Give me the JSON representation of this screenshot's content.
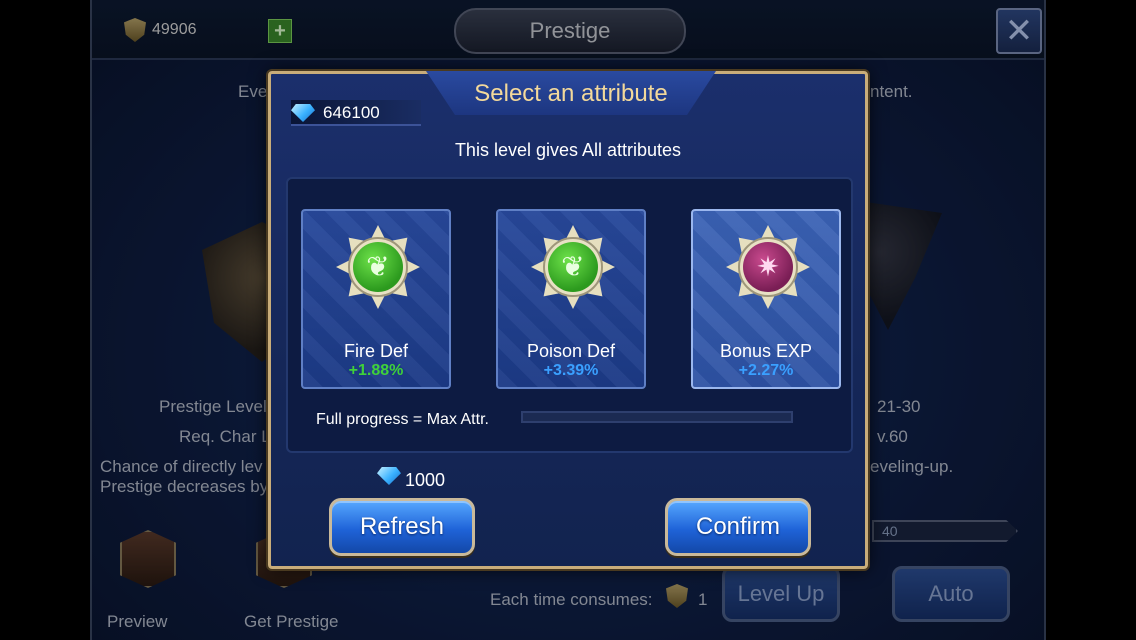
{
  "background": {
    "currency_value": "49906",
    "title": "Prestige",
    "close_glyph": "✕",
    "hint_left": "Eve",
    "hint_right": "ntent.",
    "prestige_level_label": "Prestige Level",
    "prestige_level_value": "21-30",
    "req_char_label": "Req. Char L",
    "req_char_value": "v.60",
    "chance_line1": "Chance of directly lev",
    "chance_line1_right": "eveling-up.",
    "chance_line2": "Prestige decreases by",
    "bar_text": "40",
    "preview_label": "Preview",
    "get_prestige_label": "Get Prestige",
    "consumes_label": "Each time consumes:",
    "consumes_value": "1",
    "level_up_label": "Level Up",
    "auto_label": "Auto"
  },
  "modal": {
    "title": "Select an attribute",
    "gems": "646100",
    "subtitle": "This level gives All attributes",
    "cards": [
      {
        "name": "Fire Def",
        "value": "+1.88%",
        "value_color": "#3fd13a",
        "medal": "green",
        "icon": "leaf-icon",
        "glyph": "❦"
      },
      {
        "name": "Poison Def",
        "value": "+3.39%",
        "value_color": "#3aa0ff",
        "medal": "green",
        "icon": "leaf-icon",
        "glyph": "❦"
      },
      {
        "name": "Bonus EXP",
        "value": "+2.27%",
        "value_color": "#3aa0ff",
        "medal": "purple",
        "icon": "star-icon",
        "glyph": "✷"
      }
    ],
    "progress_label": "Full progress = Max Attr.",
    "progress_fraction": 0,
    "cost": "1000",
    "refresh_label": "Refresh",
    "confirm_label": "Confirm"
  }
}
